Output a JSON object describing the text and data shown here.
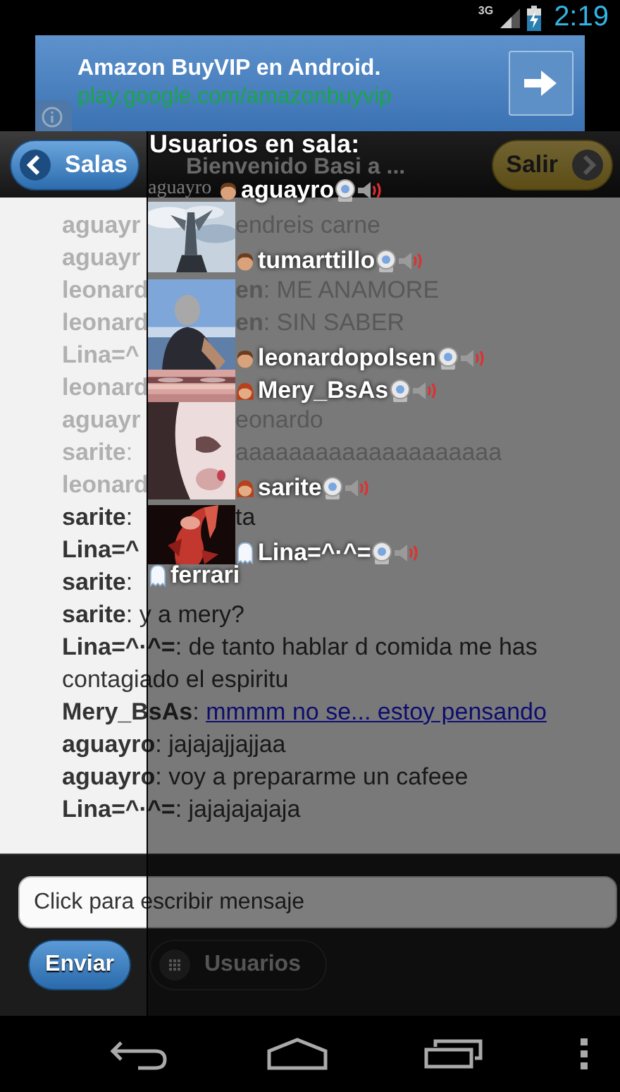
{
  "status_bar": {
    "network": "3G",
    "time": "2:19"
  },
  "ad": {
    "title": "Amazon BuyVIP en Android.",
    "url": "play.google.com/amazonbuyvip"
  },
  "header": {
    "back_button": "Salas",
    "title": "Bienvenido Basi a ...",
    "marquee": "aguayro",
    "exit_button": "Salir"
  },
  "messages": [
    {
      "kind": "split",
      "left": "**aguayr**",
      "right": "endreis carne",
      "faded": true
    },
    {
      "kind": "split",
      "left": "**aguayr**",
      "faded": true
    },
    {
      "kind": "split",
      "left": "**leonard**",
      "right": "**en**: ME ANAMORE",
      "faded": true
    },
    {
      "kind": "split",
      "left": "**leonard**",
      "right": "**en**: SIN SABER",
      "faded": true
    },
    {
      "kind": "split",
      "left": "**Lina=^**",
      "faded": true
    },
    {
      "kind": "split",
      "left": "**leonard**",
      "faded": true
    },
    {
      "kind": "split",
      "left": "**aguayr**",
      "right": "eonardo",
      "faded": true
    },
    {
      "kind": "split",
      "left": "**sarite**:",
      "right": "aaaaaaaaaaaaaaaaaaaa",
      "faded": true
    },
    {
      "kind": "split",
      "left": "**leonard**",
      "faded": true
    },
    {
      "kind": "split",
      "left": "**sarite**:",
      "right": "ta",
      "faded": false
    },
    {
      "kind": "split",
      "left": "**Lina=^**",
      "faded": false
    },
    {
      "kind": "full",
      "text": "**sarite**:",
      "faded": false
    },
    {
      "kind": "full",
      "text": "**sarite**: y a mery?",
      "faded": false
    },
    {
      "kind": "full",
      "text": "**Lina=^·^=**: de tanto hablar d comida me has contagiado el espiritu",
      "faded": false
    },
    {
      "kind": "link",
      "text": "**Mery_BsAs**:",
      "link_text": "mmmm no se... estoy pensando",
      "faded": false
    },
    {
      "kind": "full",
      "text": "**aguayro**: jajajajjajjaa",
      "faded": false
    },
    {
      "kind": "full",
      "text": "**aguayro**: voy a prepararme un cafeee",
      "faded": false
    },
    {
      "kind": "full",
      "text": "**Lina=^·^=**: jajajajajaja",
      "faded": false
    }
  ],
  "composer": {
    "placeholder": "Click para escribir mensaje",
    "send_button": "Enviar",
    "users_button": "Usuarios"
  },
  "users_panel": {
    "title": "Usuarios en sala:",
    "users": [
      {
        "name": "aguayro",
        "kind": "boy",
        "photo": false,
        "indented": true,
        "media": true
      },
      {
        "name": "tumarttillo",
        "kind": "boy",
        "photo": true,
        "indented": false,
        "media": true
      },
      {
        "name": "leonardopolsen",
        "kind": "boy",
        "photo": true,
        "indented": false,
        "media": true
      },
      {
        "name": "Mery_BsAs",
        "kind": "girl",
        "photo": true,
        "indented": false,
        "media": true
      },
      {
        "name": "sarite",
        "kind": "girl",
        "photo": true,
        "indented": false,
        "media": true
      },
      {
        "name": "Lina=^·^=",
        "kind": "ghost",
        "photo": true,
        "indented": false,
        "media": true
      },
      {
        "name": "ferrari",
        "kind": "ghost",
        "photo": false,
        "indented": false,
        "media": false
      }
    ]
  }
}
